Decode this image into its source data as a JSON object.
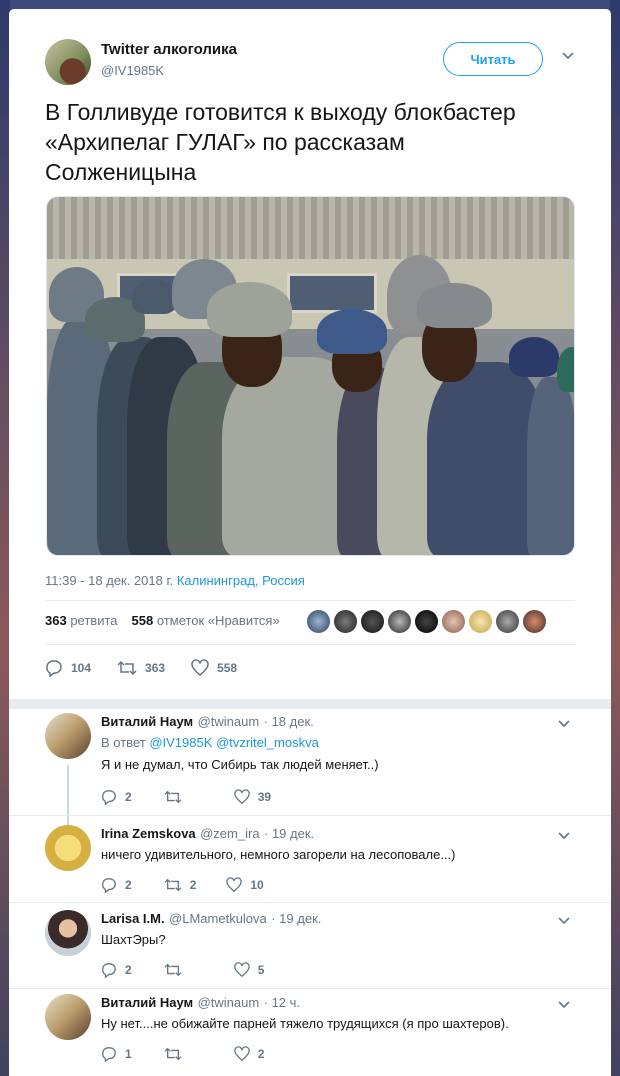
{
  "tweet": {
    "author_name": "Twitter алкоголика",
    "author_handle": "@IV1985K",
    "follow_label": "Читать",
    "text": "В Голливуде готовится к выходу блокбастер\n«Архипелаг ГУЛАГ» по рассказам\nСолженицына",
    "time": "11:39 - 18 дек. 2018 г.",
    "location": "Калининград, Россия",
    "retweets_count": "363",
    "retweets_label": "ретвита",
    "likes_count": "558",
    "likes_label": "отметок «Нравится»",
    "actions": {
      "replies": "104",
      "retweets": "363",
      "likes": "558"
    }
  },
  "replies": [
    {
      "name": "Виталий Наум",
      "handle": "@twinaum",
      "time": "· 18 дек.",
      "in_reply_prefix": "В ответ",
      "in_reply_1": "@IV1985K",
      "in_reply_2": "@tvzritel_moskva",
      "text": "Я и не думал, что Сибирь так людей меняет..)",
      "replies": "2",
      "retweets": "",
      "likes": "39"
    },
    {
      "name": "Irina Zemskova",
      "handle": "@zem_ira",
      "time": "· 19 дек.",
      "text": "ничего удивительного, немного загорели на лесоповале...)",
      "replies": "2",
      "retweets": "2",
      "likes": "10"
    },
    {
      "name": "Larisa I.M.",
      "handle": "@LMametkulova",
      "time": "· 19 дек.",
      "text": "ШахтЭры?",
      "replies": "2",
      "retweets": "",
      "likes": "5"
    },
    {
      "name": "Виталий Наум",
      "handle": "@twinaum",
      "time": "· 12 ч.",
      "text": "Ну нет....не обижайте парней тяжело трудящихся (я про шахтеров).",
      "replies": "1",
      "retweets": "",
      "likes": "2"
    }
  ],
  "colors": {
    "accent": "#1da1f2",
    "link": "#1b95e0",
    "muted": "#657786",
    "text": "#14171a"
  }
}
